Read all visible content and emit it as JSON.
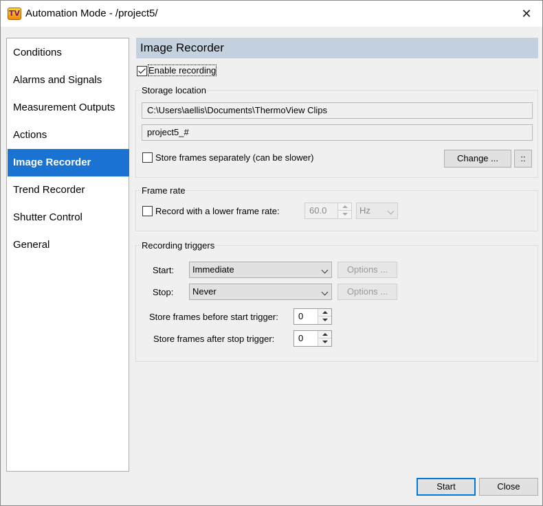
{
  "window": {
    "app_icon_text": "TV",
    "title": "Automation Mode - /project5/",
    "close_glyph": "✕"
  },
  "sidebar": {
    "items": [
      {
        "label": "Conditions"
      },
      {
        "label": "Alarms and Signals"
      },
      {
        "label": "Measurement Outputs"
      },
      {
        "label": "Actions"
      },
      {
        "label": "Image Recorder",
        "selected": true
      },
      {
        "label": "Trend Recorder"
      },
      {
        "label": "Shutter Control"
      },
      {
        "label": "General"
      }
    ]
  },
  "panel": {
    "title": "Image Recorder",
    "enable_recording": {
      "label": "Enable recording",
      "checked": true
    },
    "storage": {
      "title": "Storage location",
      "path": "C:\\Users\\aellis\\Documents\\ThermoView Clips",
      "name_pattern": "project5_#",
      "store_separately": {
        "label": "Store frames separately (can be slower)",
        "checked": false
      },
      "change_button": "Change ...",
      "more_button": "::"
    },
    "frame_rate": {
      "title": "Frame rate",
      "lower_rate": {
        "label": "Record with a lower frame rate:",
        "checked": false
      },
      "value": "60.0",
      "unit": "Hz"
    },
    "triggers": {
      "title": "Recording triggers",
      "start_label": "Start:",
      "start_value": "Immediate",
      "stop_label": "Stop:",
      "stop_value": "Never",
      "options_label": "Options ...",
      "before_label": "Store frames before start trigger:",
      "before_value": "0",
      "after_label": "Store frames after stop trigger:",
      "after_value": "0"
    }
  },
  "footer": {
    "start_button": "Start",
    "close_button": "Close"
  },
  "colors": {
    "selected_item_bg": "#1a73d2",
    "header_bg": "#c4d2e0",
    "primary_button_border": "#0078d7"
  }
}
